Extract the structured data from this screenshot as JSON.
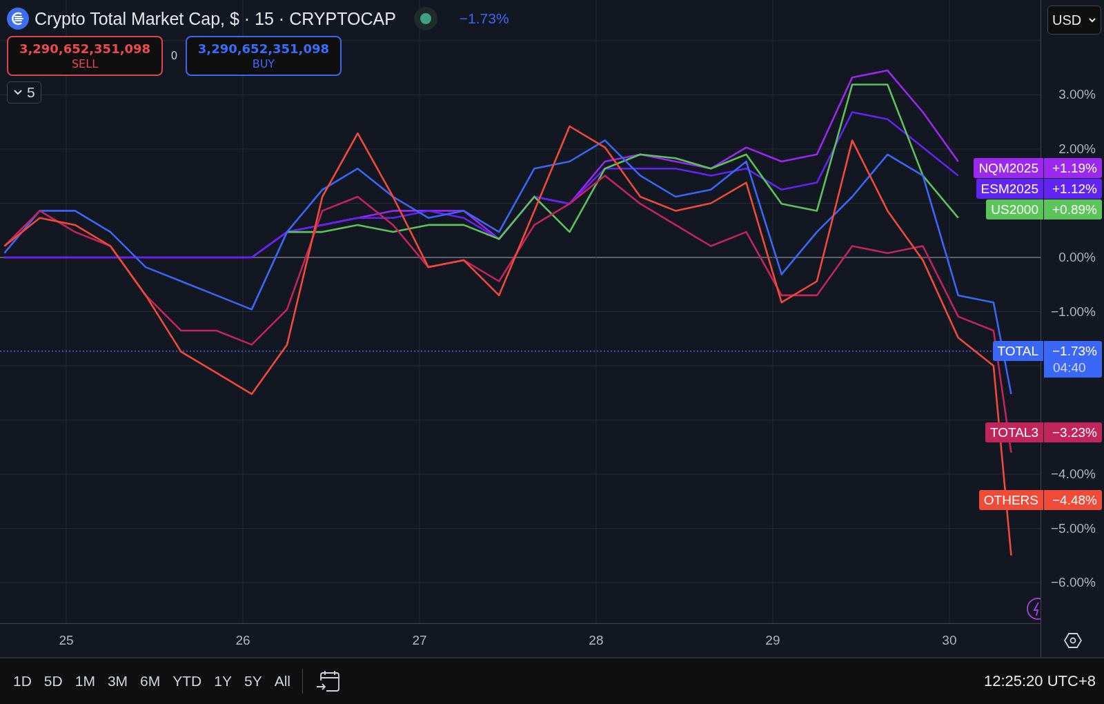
{
  "header": {
    "title": "Crypto Total Market Cap, $ · 15 · CRYPTOCAP",
    "change": "−1.73%"
  },
  "trade": {
    "sell": {
      "price": "3,290,652,351,098",
      "label": "SELL"
    },
    "spread": "0",
    "buy": {
      "price": "3,290,652,351,098",
      "label": "BUY"
    }
  },
  "indicators_toggle": {
    "count": "5"
  },
  "currency": "USD",
  "chart": {
    "chart_data": {
      "type": "line",
      "x": [
        24.65,
        24.85,
        25.05,
        25.25,
        25.45,
        25.65,
        25.85,
        26.05,
        26.25,
        26.45,
        26.65,
        26.85,
        27.05,
        27.25,
        27.45,
        27.65,
        27.85,
        28.05,
        28.25,
        28.45,
        28.65,
        28.85,
        29.05,
        29.25,
        29.45,
        29.65,
        29.85,
        30.05,
        30.25,
        30.35
      ],
      "series": [
        {
          "name": "NQM2025",
          "color": "#9c27ef",
          "values": [
            0,
            0,
            0,
            0,
            0,
            0,
            0,
            0,
            0.47,
            0.6,
            0.73,
            0.86,
            0.86,
            0.86,
            0.34,
            1.12,
            0.99,
            1.77,
            1.9,
            1.77,
            1.64,
            2.03,
            1.77,
            1.9,
            3.32,
            3.45,
            2.68,
            1.77,
            null,
            null
          ]
        },
        {
          "name": "ESM2025",
          "color": "#6224f2",
          "values": [
            0,
            0,
            0,
            0,
            0,
            0,
            0,
            0,
            0.47,
            0.6,
            0.73,
            0.73,
            0.86,
            0.73,
            0.34,
            1.12,
            0.99,
            1.64,
            1.64,
            1.64,
            1.51,
            1.64,
            1.25,
            1.38,
            2.68,
            2.55,
            2.03,
            1.51,
            null,
            null
          ]
        },
        {
          "name": "US2000",
          "color": "#5bc45b",
          "values": [
            null,
            null,
            null,
            null,
            null,
            null,
            null,
            null,
            0.47,
            0.47,
            0.6,
            0.47,
            0.6,
            0.6,
            0.34,
            1.12,
            0.47,
            1.64,
            1.9,
            1.83,
            1.64,
            1.9,
            0.99,
            0.86,
            3.19,
            3.19,
            1.51,
            0.73,
            null,
            null
          ]
        },
        {
          "name": "TOTAL",
          "color": "#3a67f5",
          "values": [
            0.08,
            0.86,
            0.86,
            0.47,
            -0.18,
            -0.44,
            -0.7,
            -0.96,
            0.47,
            1.25,
            1.64,
            1.12,
            0.73,
            0.86,
            0.47,
            1.64,
            1.77,
            2.16,
            1.51,
            1.12,
            1.25,
            1.77,
            -0.31,
            0.47,
            1.12,
            1.9,
            1.51,
            -0.7,
            -0.83,
            -2.52
          ]
        },
        {
          "name": "TOTAL3",
          "color": "#c2255c",
          "values": [
            0.21,
            0.86,
            0.47,
            0.21,
            -0.7,
            -1.35,
            -1.35,
            -1.61,
            -0.96,
            0.86,
            1.12,
            0.6,
            -0.18,
            -0.05,
            -0.44,
            0.6,
            0.99,
            1.51,
            0.99,
            0.6,
            0.21,
            0.47,
            -0.7,
            -0.7,
            0.21,
            0.08,
            0.21,
            -1.09,
            -1.35,
            -3.6
          ]
        },
        {
          "name": "OTHERS",
          "color": "#f04a38",
          "values": [
            0.21,
            0.73,
            0.6,
            0.21,
            -0.7,
            -1.74,
            -2.13,
            -2.52,
            -1.61,
            1.12,
            2.29,
            1.12,
            -0.18,
            -0.05,
            -0.7,
            0.86,
            2.42,
            2.03,
            1.12,
            0.86,
            1.0,
            1.38,
            -0.83,
            -0.44,
            2.16,
            0.86,
            -0.05,
            -1.48,
            -2.0,
            -5.5
          ]
        }
      ],
      "xlim": [
        24.625,
        30.516
      ],
      "ylim": [
        -6.75,
        4.75
      ],
      "xticks": [
        {
          "value": 25,
          "label": "25"
        },
        {
          "value": 26,
          "label": "26"
        },
        {
          "value": 27,
          "label": "27"
        },
        {
          "value": 28,
          "label": "28"
        },
        {
          "value": 29,
          "label": "29"
        },
        {
          "value": 30,
          "label": "30"
        }
      ],
      "yticks": [
        {
          "value": 3,
          "label": "3.00%"
        },
        {
          "value": 2,
          "label": "2.00%"
        },
        {
          "value": 0,
          "label": "0.00%"
        },
        {
          "value": -1,
          "label": "−1.00%"
        },
        {
          "value": -4,
          "label": "−4.00%"
        },
        {
          "value": -5,
          "label": "−5.00%"
        },
        {
          "value": -6,
          "label": "−6.00%"
        }
      ],
      "grid": true,
      "legend": true,
      "ref_lines": [
        {
          "axis": "y",
          "value": -1.73
        }
      ]
    }
  },
  "price_labels": [
    {
      "value": "+1.19%"
    },
    {
      "value": "+1.12%"
    },
    {
      "value": "+0.89%"
    },
    {
      "value": "−1.73%",
      "countdown": "04:40"
    },
    {
      "value": "−3.23%"
    },
    {
      "value": "−4.48%"
    }
  ],
  "ranges": [
    "1D",
    "5D",
    "1M",
    "3M",
    "6M",
    "YTD",
    "1Y",
    "5Y",
    "All"
  ],
  "clock": "12:25:20 UTC+8"
}
